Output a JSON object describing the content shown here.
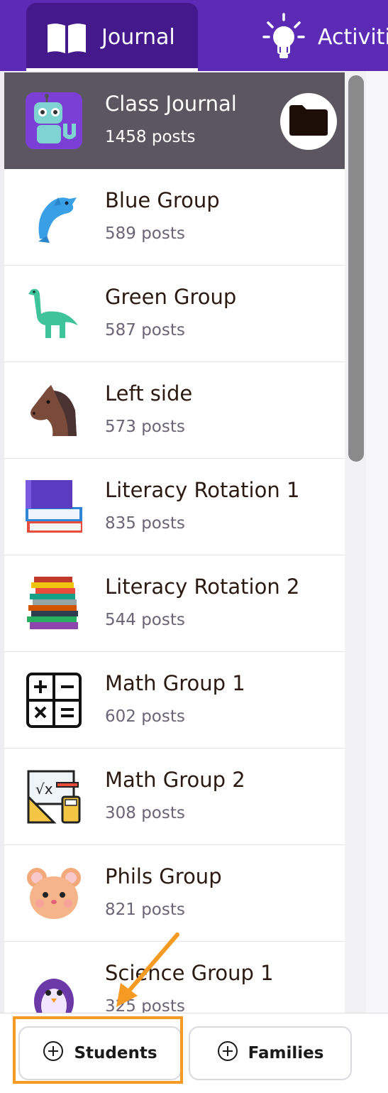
{
  "tabs": {
    "journal_label": "Journal",
    "activities_label": "Activiti"
  },
  "groups": [
    {
      "name": "Class Journal",
      "posts": "1458 posts",
      "avatar": "robot-icon",
      "selected": true
    },
    {
      "name": "Blue Group",
      "posts": "589 posts",
      "avatar": "dolphin-icon"
    },
    {
      "name": "Green Group",
      "posts": "587 posts",
      "avatar": "dinosaur-icon"
    },
    {
      "name": "Left side",
      "posts": "573 posts",
      "avatar": "horse-icon"
    },
    {
      "name": "Literacy Rotation 1",
      "posts": "835 posts",
      "avatar": "books-icon"
    },
    {
      "name": "Literacy Rotation 2",
      "posts": "544 posts",
      "avatar": "book-stack-icon"
    },
    {
      "name": "Math Group 1",
      "posts": "602 posts",
      "avatar": "math-symbols-icon"
    },
    {
      "name": "Math Group 2",
      "posts": "308 posts",
      "avatar": "math-board-icon"
    },
    {
      "name": "Phils Group",
      "posts": "821 posts",
      "avatar": "hamster-icon"
    },
    {
      "name": "Science Group 1",
      "posts": "325 posts",
      "avatar": "penguin-icon"
    }
  ],
  "bottom": {
    "students_label": "Students",
    "families_label": "Families"
  },
  "colors": {
    "brand": "#5b2bb5",
    "active_tab": "#43198b",
    "selected_row": "#5c5660",
    "highlight": "#f59a23"
  }
}
